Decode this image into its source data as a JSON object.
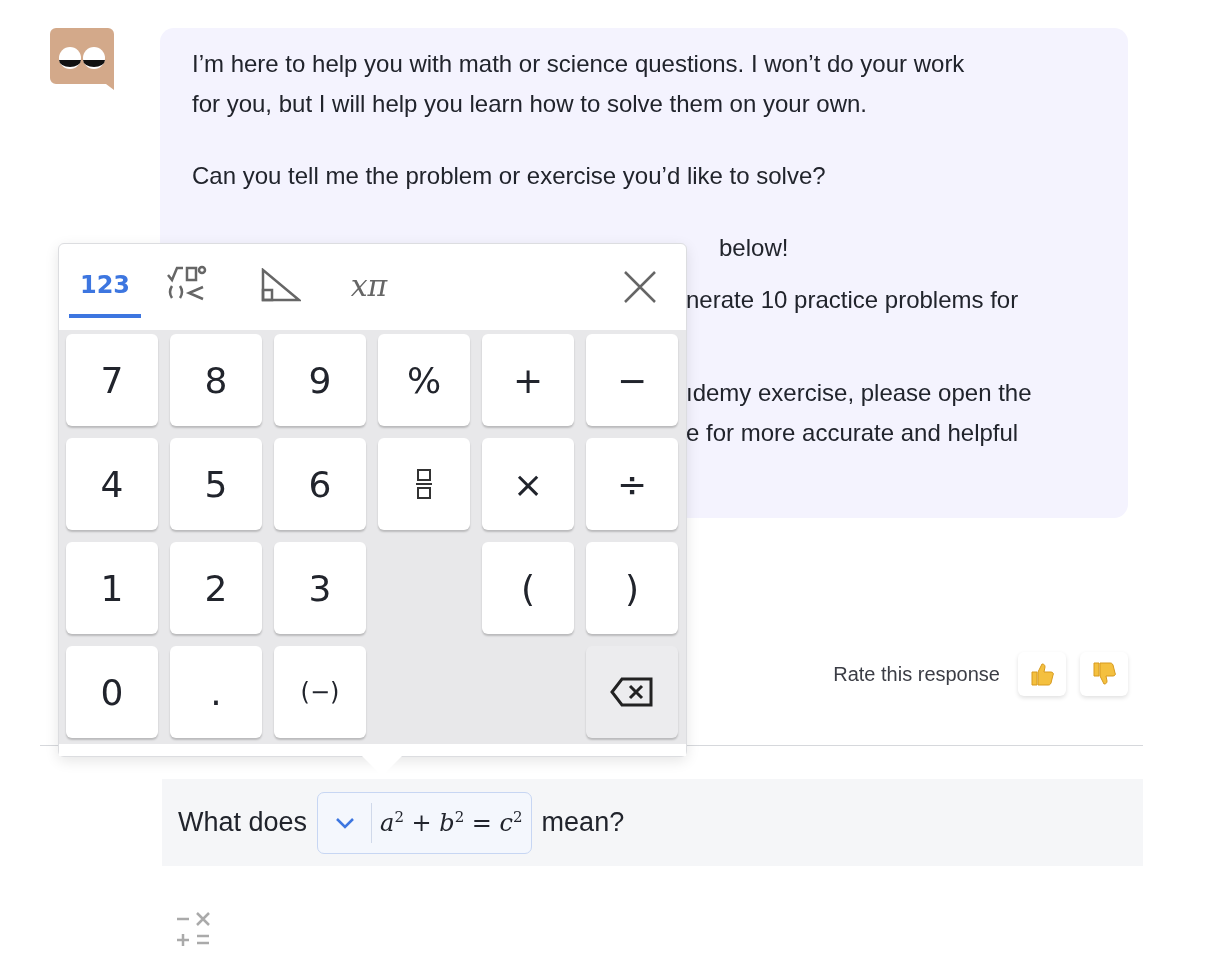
{
  "message": {
    "paragraphs": [
      "I’m here to help you with math or science questions. I won’t do your work for you, but I will help you learn how to solve them on your own.",
      "Can you tell me the problem or exercise you’d like to solve?"
    ],
    "fragments": [
      "below!",
      "nerate 10 practice problems for",
      "ıdemy exercise, please open the",
      "e for more accurate and helpful"
    ]
  },
  "keypad": {
    "tabs": [
      {
        "kind": "text",
        "label": "123",
        "selected": true
      },
      {
        "kind": "relations",
        "selected": false
      },
      {
        "kind": "geometry",
        "selected": false
      },
      {
        "kind": "text",
        "label": "xπ",
        "selected": false
      }
    ],
    "rows": [
      [
        {
          "kind": "key",
          "label": "7"
        },
        {
          "kind": "key",
          "label": "8"
        },
        {
          "kind": "key",
          "label": "9"
        },
        {
          "kind": "key",
          "label": "%"
        },
        {
          "kind": "key",
          "label": "+"
        },
        {
          "kind": "key",
          "label": "−"
        }
      ],
      [
        {
          "kind": "key",
          "label": "4"
        },
        {
          "kind": "key",
          "label": "5"
        },
        {
          "kind": "key",
          "label": "6"
        },
        {
          "kind": "fraction"
        },
        {
          "kind": "key",
          "label": "×"
        },
        {
          "kind": "key",
          "label": "÷"
        }
      ],
      [
        {
          "kind": "key",
          "label": "1"
        },
        {
          "kind": "key",
          "label": "2"
        },
        {
          "kind": "key",
          "label": "3"
        },
        {
          "kind": "blank"
        },
        {
          "kind": "key",
          "label": "("
        },
        {
          "kind": "key",
          "label": ")"
        }
      ],
      [
        {
          "kind": "key",
          "label": "0"
        },
        {
          "kind": "key",
          "label": "."
        },
        {
          "kind": "key",
          "label": "(−)"
        },
        {
          "kind": "blank"
        },
        {
          "kind": "blank"
        },
        {
          "kind": "backspace"
        }
      ]
    ]
  },
  "rating": {
    "label": "Rate this response"
  },
  "input": {
    "before": "What does",
    "math": "*a*$^{2}$ + *b*$^{2}$ = *c*$^{2}$",
    "after": "mean?"
  }
}
